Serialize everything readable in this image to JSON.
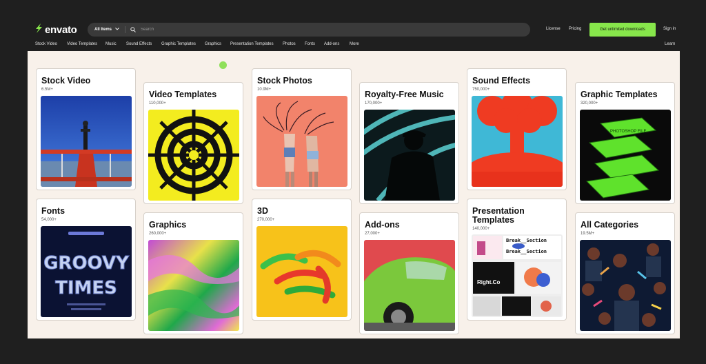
{
  "brand": {
    "name": "envato",
    "color": "#87e64b"
  },
  "search": {
    "category": "All Items",
    "placeholder": "Search"
  },
  "header_links": {
    "license": "License",
    "pricing": "Pricing",
    "cta": "Get unlimited downloads",
    "signin": "Sign in"
  },
  "nav": {
    "items": [
      "Stock Video",
      "Video Templates",
      "Music",
      "Sound Effects",
      "Graphic Templates",
      "Graphics",
      "Presentation Templates",
      "Photos",
      "Fonts",
      "Add-ons",
      "More"
    ],
    "learn": "Learn"
  },
  "cards": [
    {
      "title": "Stock Video",
      "count": "6.5M+",
      "image": "biplane-wingwalker"
    },
    {
      "title": "Video Templates",
      "count": "110,000+",
      "image": "yellow-black-swirl-pattern"
    },
    {
      "title": "Stock Photos",
      "count": "10.9M+",
      "image": "two-women-hair-flip"
    },
    {
      "title": "Royalty-Free Music",
      "count": "170,000+",
      "image": "silhouette-dj"
    },
    {
      "title": "Sound Effects",
      "count": "750,000+",
      "image": "red-mushroom-cloud"
    },
    {
      "title": "Graphic Templates",
      "count": "320,000+",
      "image": "green-photoshop-boxes"
    },
    {
      "title": "Fonts",
      "count": "54,000+",
      "image": "chrome-groovy-type-poster"
    },
    {
      "title": "Graphics",
      "count": "260,000+",
      "image": "neon-gradient-waves"
    },
    {
      "title": "3D",
      "count": "270,000+",
      "image": "gummy-worms"
    },
    {
      "title": "Add-ons",
      "count": "27,000+",
      "image": "green-vintage-car"
    },
    {
      "title": "Presentation Templates",
      "count": "140,000+",
      "image": "presentation-slides-collage"
    },
    {
      "title": "All Categories",
      "count": "19.5M+",
      "image": "holographic-portraits"
    }
  ],
  "font_poster": {
    "line1": "GROOVY",
    "line2": "TIMES"
  },
  "slides": {
    "break1": "Break__Section",
    "break2": "Break__Section",
    "right": "Right.Co"
  },
  "boxes_text": "PHOTOSHOP FILE"
}
